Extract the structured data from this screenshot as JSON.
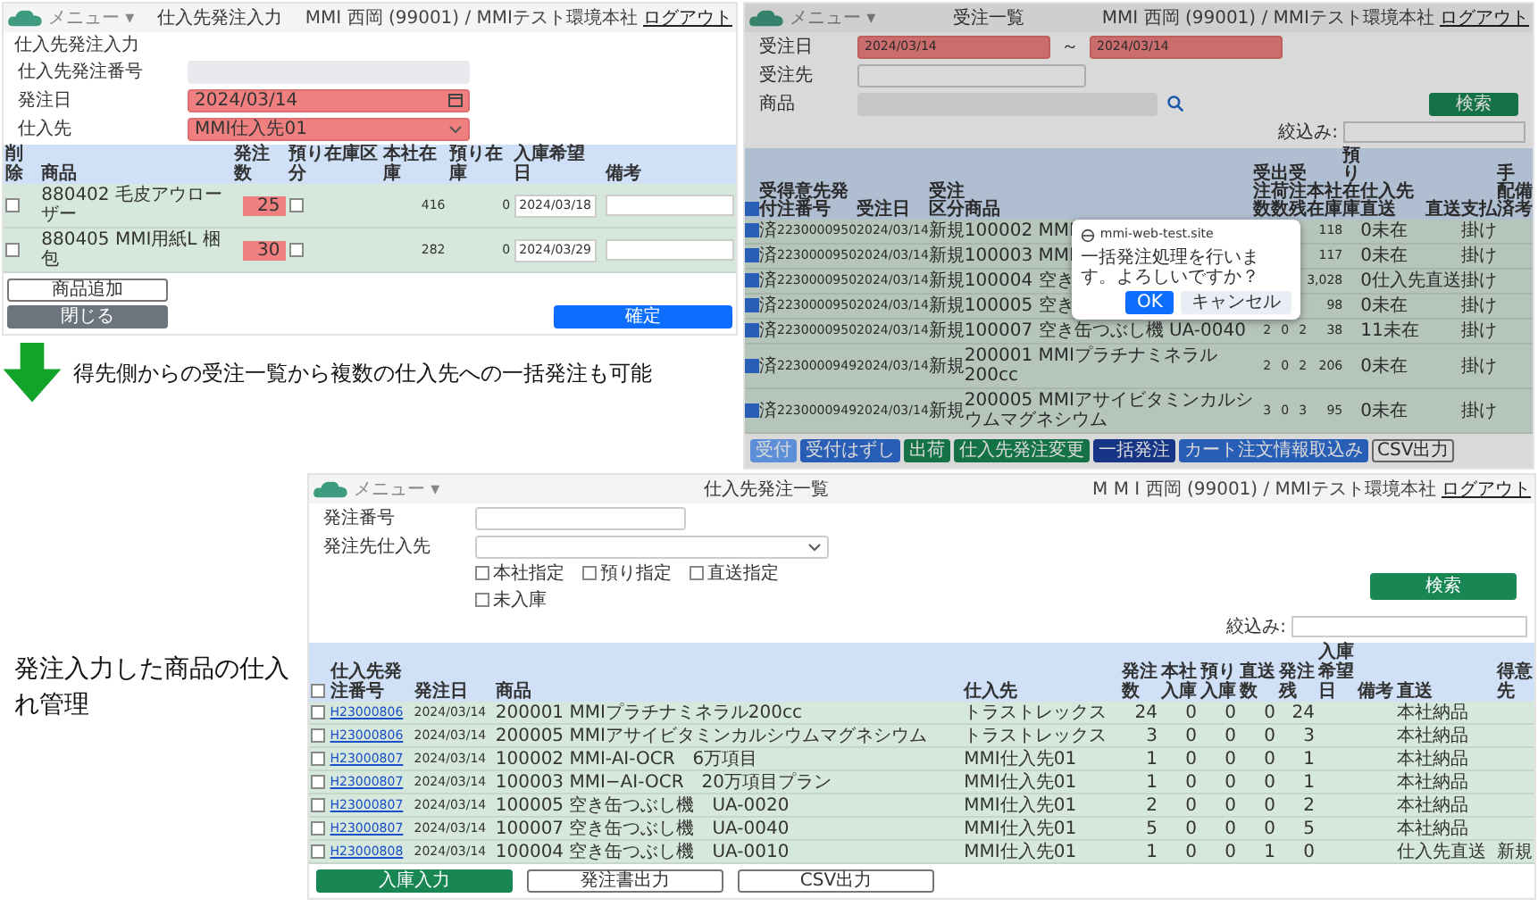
{
  "order_entry_screen": {
    "header": {
      "menu": "メニュー ▾",
      "title": "仕入先発注入力",
      "user": "MMI 西岡 (99001) / MMIテスト環境本社",
      "logout": "ログアウト"
    },
    "section_title": "仕入先発注入力",
    "fields": [
      {
        "label": "仕入先発注番号",
        "kind": "readonly",
        "required": false
      },
      {
        "label": "発注日",
        "kind": "date",
        "value": "2024/03/14",
        "required": true
      },
      {
        "label": "仕入先",
        "kind": "select",
        "value": "MMI仕入先01",
        "required": true
      }
    ],
    "columns": [
      "削除",
      "商品",
      "発注数",
      "預り在庫区分",
      "本社在庫",
      "預り在庫",
      "入庫希望日",
      "備考"
    ],
    "rows": [
      {
        "checked": false,
        "product": "880402 毛皮アウローザー",
        "qty": "25",
        "deposit": false,
        "hq_stock": "416",
        "dep_stock": "0",
        "date": "2024/03/18"
      },
      {
        "checked": false,
        "product": "880405 MMI用紙L 梱包",
        "qty": "30",
        "deposit": false,
        "hq_stock": "282",
        "dep_stock": "0",
        "date": "2024/03/29"
      }
    ],
    "buttons": [
      {
        "label": "商品追加",
        "kind": "outline"
      },
      {
        "label": "閉じる",
        "kind": "gray"
      },
      {
        "label": "確定",
        "kind": "primary"
      }
    ]
  },
  "sales_order_screen": {
    "header": {
      "menu": "メニュー ▾",
      "title": "受注一覧",
      "user": "MMI 西岡 (99001) / MMIテスト環境本社",
      "logout": "ログアウト"
    },
    "date_label": "受注日",
    "date_from": "2024/03/14",
    "date_sep": "～",
    "date_to": "2024/03/14",
    "customer_label": "受注先",
    "product_label": "商品",
    "search": "検索",
    "filter_label": "絞込み:",
    "all_checked": true,
    "columns": [
      "受付",
      "得意先発注番号",
      "受注日",
      "受注区分",
      "商品",
      "受注数",
      "出荷数",
      "受注残",
      "本社在庫",
      "預り在庫",
      "仕入先直送",
      "直送",
      "支払",
      "手配済",
      "備考"
    ],
    "rows": [
      {
        "checked": true,
        "status": "済",
        "no": "2230000950",
        "date": "2024/03/14",
        "type": "新規",
        "product": "100002 MMI",
        "hq_stock": "118",
        "supplier": "0未在",
        "payment": "掛け"
      },
      {
        "checked": true,
        "status": "済",
        "no": "2230000950",
        "date": "2024/03/14",
        "type": "新規",
        "product": "100003 MMI",
        "hq_stock": "117",
        "supplier": "0未在",
        "payment": "掛け"
      },
      {
        "checked": true,
        "status": "済",
        "no": "2230000950",
        "date": "2024/03/14",
        "type": "新規",
        "product": "100004 空き",
        "hq_stock": "3,028",
        "supplier": "0仕入先",
        "direct": "直送",
        "payment": "掛け"
      },
      {
        "checked": true,
        "status": "済",
        "no": "2230000950",
        "date": "2024/03/14",
        "type": "新規",
        "product": "100005 空き",
        "hq_stock": "98",
        "supplier": "0未在",
        "payment": "掛け"
      },
      {
        "checked": true,
        "status": "済",
        "no": "2230000950",
        "date": "2024/03/14",
        "type": "新規",
        "product": "100007 空き缶つぶし機 UA-0040",
        "ordered": "2",
        "shipped": "0",
        "remaining": "2",
        "hq_stock": "38",
        "supplier": "11未在",
        "payment": "掛け"
      },
      {
        "checked": true,
        "status": "済",
        "no": "2230000949",
        "date": "2024/03/14",
        "type": "新規",
        "product": "200001 MMIプラチナミネラル200cc",
        "ordered": "2",
        "shipped": "0",
        "remaining": "2",
        "hq_stock": "206",
        "supplier": "0未在",
        "payment": "掛け"
      },
      {
        "checked": true,
        "status": "済",
        "no": "2230000949",
        "date": "2024/03/14",
        "type": "新規",
        "product": "200005 MMIアサイビタミンカルシウムマグネシウム",
        "ordered": "3",
        "shipped": "0",
        "remaining": "3",
        "hq_stock": "95",
        "supplier": "0未在",
        "payment": "掛け"
      }
    ],
    "dialog": {
      "site": "mmi-web-test.site",
      "message": "一括発注処理を行います。よろしいですか？",
      "ok": "OK",
      "cancel": "キャンセル"
    },
    "buttons": [
      {
        "label": "受付",
        "kind": "light"
      },
      {
        "label": "受付はずし",
        "kind": "blue"
      },
      {
        "label": "出荷",
        "kind": "green"
      },
      {
        "label": "仕入先発注変更",
        "kind": "green"
      },
      {
        "label": "一括発注",
        "kind": "navy"
      },
      {
        "label": "カート注文情報取込み",
        "kind": "blue"
      },
      {
        "label": "CSV出力",
        "kind": "outline"
      }
    ]
  },
  "caption": "得先側からの受注一覧から複数の仕入先への一括発注も可能",
  "side_note": "発注入力した商品の仕入れ管理",
  "purchase_order_list": {
    "header": {
      "menu": "メニュー ▾",
      "title": "仕入先発注一覧",
      "user": "M M I 西岡 (99001) / MMIテスト環境本社",
      "logout": "ログアウト"
    },
    "order_no_label": "発注番号",
    "supplier_label": "発注先仕入先",
    "options": [
      {
        "label": "本社指定",
        "checked": false
      },
      {
        "label": "預り指定",
        "checked": false
      },
      {
        "label": "直送指定",
        "checked": false
      },
      {
        "label": "未入庫",
        "checked": false
      }
    ],
    "search": "検索",
    "filter_label": "絞込み:",
    "all_checked": false,
    "columns": [
      "仕入先発注番号",
      "発注日",
      "商品",
      "仕入先",
      "発注数",
      "本社入庫",
      "預り入庫",
      "直送数",
      "発注残",
      "入庫希望日",
      "備考",
      "直送",
      "得意先"
    ],
    "rows": [
      {
        "checked": false,
        "no": "H23000806",
        "date": "2024/03/14",
        "product": "200001 MMIプラチナミネラル200cc",
        "supplier": "トラストレックス",
        "ordered": "24",
        "hq_in": "0",
        "dep_in": "0",
        "direct_qty": "0",
        "remaining": "24",
        "delivery": "本社納品"
      },
      {
        "checked": false,
        "no": "H23000806",
        "date": "2024/03/14",
        "product": "200005 MMIアサイビタミンカルシウムマグネシウム",
        "supplier": "トラストレックス",
        "ordered": "3",
        "hq_in": "0",
        "dep_in": "0",
        "direct_qty": "0",
        "remaining": "3",
        "delivery": "本社納品"
      },
      {
        "checked": false,
        "no": "H23000807",
        "date": "2024/03/14",
        "product": "100002 MMI-AI-OCR　6万項目",
        "supplier": "MMI仕入先01",
        "ordered": "1",
        "hq_in": "0",
        "dep_in": "0",
        "direct_qty": "0",
        "remaining": "1",
        "delivery": "本社納品"
      },
      {
        "checked": false,
        "no": "H23000807",
        "date": "2024/03/14",
        "product": "100003 MMI−AI-OCR　20万項目プラン",
        "supplier": "MMI仕入先01",
        "ordered": "1",
        "hq_in": "0",
        "dep_in": "0",
        "direct_qty": "0",
        "remaining": "1",
        "delivery": "本社納品"
      },
      {
        "checked": false,
        "no": "H23000807",
        "date": "2024/03/14",
        "product": "100005 空き缶つぶし機　UA-0020",
        "supplier": "MMI仕入先01",
        "ordered": "2",
        "hq_in": "0",
        "dep_in": "0",
        "direct_qty": "0",
        "remaining": "2",
        "delivery": "本社納品"
      },
      {
        "checked": false,
        "no": "H23000807",
        "date": "2024/03/14",
        "product": "100007 空き缶つぶし機　UA-0040",
        "supplier": "MMI仕入先01",
        "ordered": "5",
        "hq_in": "0",
        "dep_in": "0",
        "direct_qty": "0",
        "remaining": "5",
        "delivery": "本社納品"
      },
      {
        "checked": false,
        "no": "H23000808",
        "date": "2024/03/14",
        "product": "100004 空き缶つぶし機　UA-0010",
        "supplier": "MMI仕入先01",
        "ordered": "1",
        "hq_in": "0",
        "dep_in": "0",
        "direct_qty": "1",
        "remaining": "0",
        "delivery": "仕入先直送",
        "customer": "新規"
      }
    ],
    "buttons": [
      {
        "label": "入庫入力",
        "kind": "green"
      },
      {
        "label": "発注書出力",
        "kind": "outline"
      },
      {
        "label": "CSV出力",
        "kind": "outline"
      }
    ]
  }
}
